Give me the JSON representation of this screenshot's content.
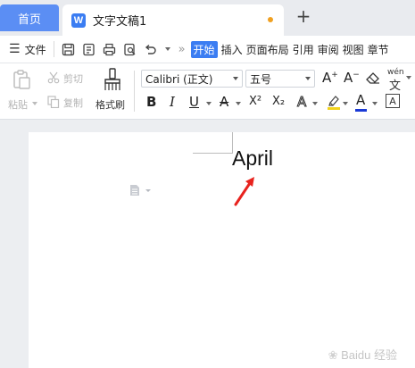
{
  "tabs": {
    "home_label": "首页",
    "doc_icon_letter": "W",
    "doc_title": "文字文稿1",
    "new_tab_symbol": "+"
  },
  "menu": {
    "file_label": "文件",
    "more_symbol": "»",
    "tabs": [
      "开始",
      "插入",
      "页面布局",
      "引用",
      "审阅",
      "视图",
      "章节"
    ],
    "active_tab": "开始"
  },
  "ribbon": {
    "paste_label": "粘贴",
    "cut_label": "剪切",
    "copy_label": "复制",
    "format_painter_label": "格式刷",
    "font_name": "Calibri (正文)",
    "font_size": "五号",
    "bold": "B",
    "italic": "I",
    "underline": "U",
    "strikethrough": "A",
    "superscript": "X²",
    "subscript": "X₂",
    "text_effect": "A",
    "font_color": "A",
    "char_border": "A",
    "phonetic": "wén",
    "font_color_hex": "#1a3ad6",
    "highlight_color_hex": "#f2d21b"
  },
  "document": {
    "text": "April",
    "annotation_color": "#e8231e"
  },
  "watermark": {
    "text": "Baidu 经验"
  }
}
